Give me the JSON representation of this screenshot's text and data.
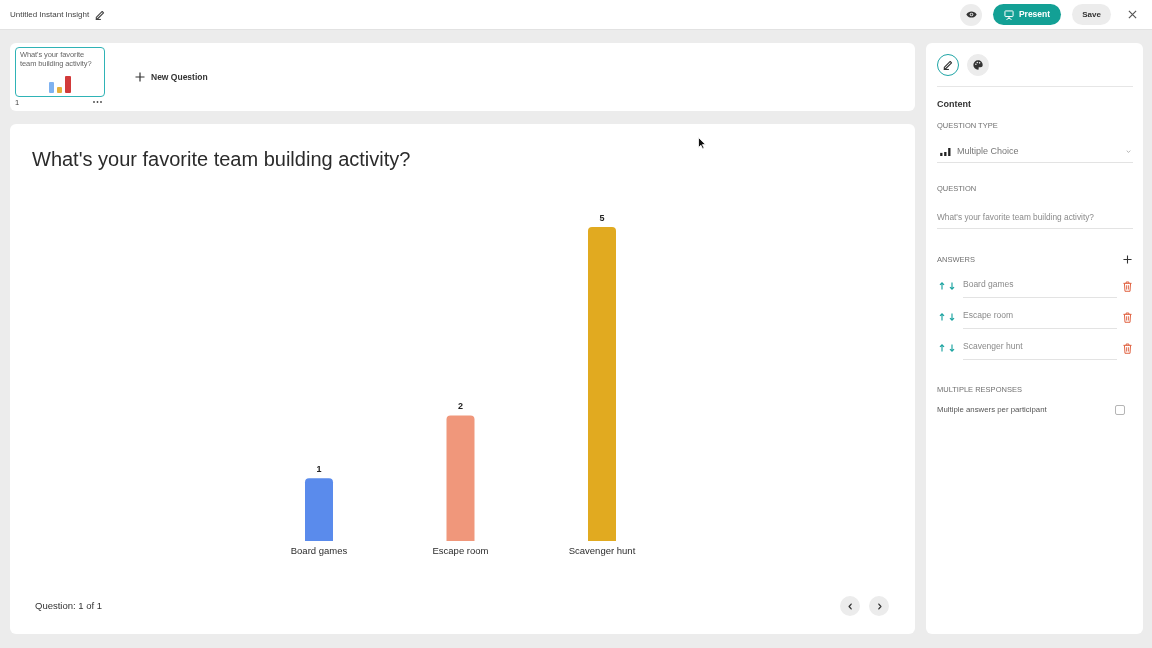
{
  "header": {
    "title": "Untitled Instant Insight",
    "actions": [
      {
        "kind": "preview"
      },
      {
        "kind": "present",
        "label": "Present"
      },
      {
        "kind": "save",
        "label": "Save"
      },
      {
        "kind": "close"
      }
    ]
  },
  "slides": [
    {
      "number": "1",
      "title": "What's your favorite team building activity?",
      "selected": true
    }
  ],
  "new_question": {
    "label": "New Question"
  },
  "question": {
    "title": "What's your favorite team building activity?",
    "chart_data": {
      "type": "bar",
      "categories": [
        "Board games",
        "Escape room",
        "Scavenger hunt"
      ],
      "values": [
        1,
        2,
        5
      ],
      "colors": [
        "#5a8bec",
        "#f0977b",
        "#e1aa20"
      ],
      "data_labels": true
    }
  },
  "footer": {
    "position": "Question: 1 of 1"
  },
  "panel": {
    "tabs": [
      {
        "kind": "edit",
        "selected": true
      },
      {
        "kind": "design",
        "selected": false
      }
    ],
    "section": "Content",
    "question_type": {
      "label": "QUESTION TYPE",
      "value": "Multiple Choice"
    },
    "question": {
      "label": "QUESTION",
      "value": "What's your favorite team building activity?"
    },
    "answers": {
      "label": "ANSWERS",
      "items": [
        {
          "value": "Board games"
        },
        {
          "value": "Escape room"
        },
        {
          "value": "Scavenger hunt"
        }
      ]
    },
    "multiple_responses": {
      "label": "MULTIPLE RESPONSES",
      "option": "Multiple answers per participant",
      "checked": false
    }
  }
}
